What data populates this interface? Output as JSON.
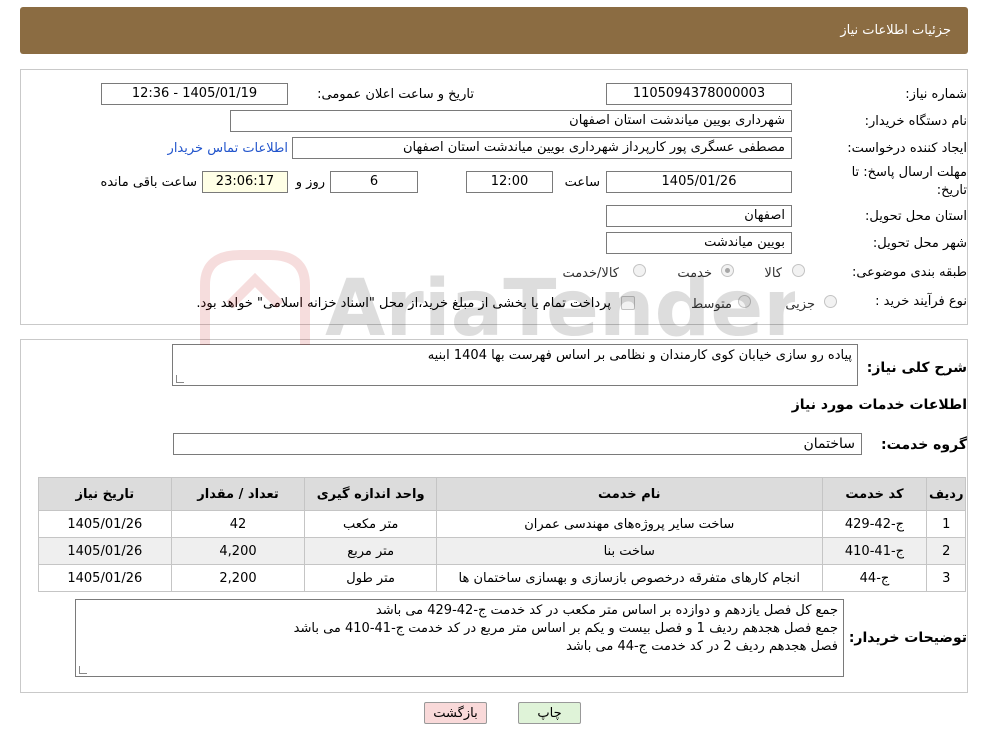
{
  "header": {
    "title": "جزئیات اطلاعات نیاز"
  },
  "info": {
    "need_number_label": "شماره نیاز:",
    "need_number": "1105094378000003",
    "announce_label": "تاریخ و ساعت اعلان عمومی:",
    "announce_value": "1405/01/19 - 12:36",
    "buyer_org_label": "نام دستگاه خریدار:",
    "buyer_org": "شهرداری بویین میاندشت استان اصفهان",
    "creator_label": "ایجاد کننده درخواست:",
    "creator": "مصطفی عسگری پور کارپرداز شهرداری بویین میاندشت استان اصفهان",
    "contact_link": "اطلاعات تماس خریدار",
    "deadline_label_1": "مهلت ارسال پاسخ: تا",
    "deadline_label_2": "تاریخ:",
    "deadline_date": "1405/01/26",
    "time_label": "ساعت",
    "deadline_time": "12:00",
    "days_value": "6",
    "days_label": "روز و",
    "remaining_time": "23:06:17",
    "remaining_label": "ساعت باقی مانده",
    "province_label": "استان محل تحویل:",
    "province": "اصفهان",
    "city_label": "شهر محل تحویل:",
    "city": "بویین میاندشت",
    "category_label": "طبقه بندی موضوعی:",
    "category_options": [
      "کالا",
      "خدمت",
      "کالا/خدمت"
    ],
    "category_selected": "خدمت",
    "process_label": "نوع فرآیند خرید :",
    "process_options": [
      "جزیی",
      "متوسط"
    ],
    "process_note": "پرداخت تمام یا بخشی از مبلغ خرید،از محل \"اسناد خزانه اسلامی\" خواهد بود."
  },
  "summary": {
    "label": "شرح کلی نیاز:",
    "text": "پیاده رو سازی خیابان کوی کارمندان و نظامی بر اساس فهرست بها 1404 ابنیه"
  },
  "services": {
    "section_title": "اطلاعات خدمات مورد نیاز",
    "group_label": "گروه خدمت:",
    "group_value": "ساختمان",
    "columns": [
      "ردیف",
      "کد خدمت",
      "نام خدمت",
      "واحد اندازه گیری",
      "تعداد / مقدار",
      "تاریخ نیاز"
    ],
    "rows": [
      {
        "row": "1",
        "code": "ج-42-429",
        "name": "ساخت سایر پروژه‌های مهندسی عمران",
        "unit": "متر مکعب",
        "qty": "42",
        "date": "1405/01/26"
      },
      {
        "row": "2",
        "code": "ج-41-410",
        "name": "ساخت بنا",
        "unit": "متر مربع",
        "qty": "4,200",
        "date": "1405/01/26"
      },
      {
        "row": "3",
        "code": "ج-44",
        "name": "انجام کارهای متفرقه درخصوص بازسازی و بهسازی ساختمان ها",
        "unit": "متر طول",
        "qty": "2,200",
        "date": "1405/01/26"
      }
    ]
  },
  "buyer_notes": {
    "label": "توضیحات خریدار:",
    "lines": [
      "جمع کل فصل یازدهم و دوازده بر اساس متر مکعب در کد خدمت ج-42-429 می باشد",
      "جمع فصل هجدهم ردیف 1 و فصل بیست و یکم بر اساس متر مربع در کد خدمت ج-41-410 می باشد",
      "فصل هجدهم ردیف 2 در کد خدمت ج-44 می باشد"
    ]
  },
  "buttons": {
    "print": "چاپ",
    "back": "بازگشت"
  },
  "watermark": {
    "text": "AriaTender.neT"
  },
  "colors": {
    "header_bg": "#8b6c42",
    "link": "#2255cc",
    "back_button_bg": "#f9d9d9",
    "print_button_bg": "#dff3d8"
  }
}
